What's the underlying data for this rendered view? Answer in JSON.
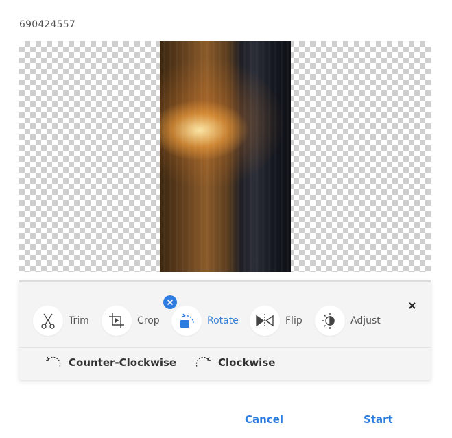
{
  "file_id": "690424557",
  "tools": [
    {
      "label": "Trim",
      "icon": "scissors-icon"
    },
    {
      "label": "Crop",
      "icon": "crop-icon"
    },
    {
      "label": "Rotate",
      "icon": "rotate-icon",
      "active": true
    },
    {
      "label": "Flip",
      "icon": "flip-icon"
    },
    {
      "label": "Adjust",
      "icon": "adjust-icon"
    }
  ],
  "rotate_options": {
    "counter_clockwise": "Counter-Clockwise",
    "clockwise": "Clockwise"
  },
  "actions": {
    "cancel": "Cancel",
    "start": "Start"
  },
  "colors": {
    "accent": "#2d7de0",
    "toolbar_bg": "#f4f4f4"
  }
}
